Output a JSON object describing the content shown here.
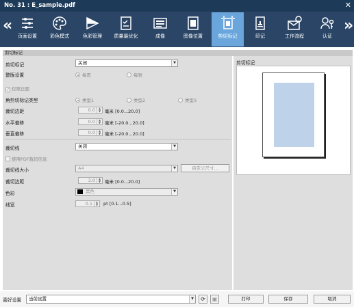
{
  "window": {
    "title": "No. 31 : E_sample.pdf",
    "close": "✕"
  },
  "nav": {
    "prev": "«",
    "next": "»"
  },
  "tabs": [
    {
      "label": "页面设置",
      "icon": "page-setup-icon"
    },
    {
      "label": "彩色模式",
      "icon": "color-mode-icon"
    },
    {
      "label": "色彩管理",
      "icon": "color-management-icon"
    },
    {
      "label": "质量最优化",
      "icon": "quality-optimization-icon"
    },
    {
      "label": "成像",
      "icon": "imaging-icon"
    },
    {
      "label": "图像位置",
      "icon": "image-position-icon"
    },
    {
      "label": "剪切标记",
      "icon": "crop-marks-icon",
      "active": true
    },
    {
      "label": "印记",
      "icon": "stamp-icon"
    },
    {
      "label": "工作流程",
      "icon": "workflow-icon"
    },
    {
      "label": "认证",
      "icon": "authentication-icon"
    }
  ],
  "section_title": "剪切标记",
  "form": {
    "crop_marks_label": "剪切标记",
    "crop_marks_value": "关闭",
    "layout_label": "整版设置",
    "per_page": "每页",
    "per_sheet": "每张",
    "front_only": "仅限正面",
    "corner_type_label": "角剪切标记类型",
    "type1": "类型1",
    "type2": "类型2",
    "type3": "类型3",
    "crop_margin_label": "裁切边距",
    "crop_margin_value": "0.0",
    "crop_margin_unit": "毫米 [0.0...20.0]",
    "h_offset_label": "水平偏移",
    "h_offset_value": "0.0",
    "h_offset_unit": "毫米 [-20.0...20.0]",
    "v_offset_label": "垂直偏移",
    "v_offset_value": "0.0",
    "v_offset_unit": "毫米 [-20.0...20.0]",
    "trim_line_label": "裁切线",
    "trim_line_value": "关闭",
    "use_pdf_trim": "使用PDF裁切信息",
    "trim_size_label": "裁切线大小",
    "trim_size_value": "A4",
    "custom_size_button": "自定义尺寸...",
    "trim_margin_label": "裁切边距",
    "trim_margin_value": "3.0",
    "trim_margin_unit": "毫米 [0.0...20.0]",
    "color_label": "色彩",
    "color_value": "黑色",
    "line_width_label": "线宽",
    "line_width_value": "0.1",
    "line_width_unit": "pt [0.1...0.5]"
  },
  "preview": {
    "title": "剪切标记"
  },
  "footer": {
    "favorites_label": "喜好设置",
    "favorites_value": "当前设置",
    "print": "打印",
    "save": "保存",
    "cancel": "取消"
  },
  "colors": {
    "titlebar": "#1d3a58",
    "ribbon": "#2a4566",
    "active_tab": "#6aa6dc",
    "preview_image": "#bed3ea"
  }
}
